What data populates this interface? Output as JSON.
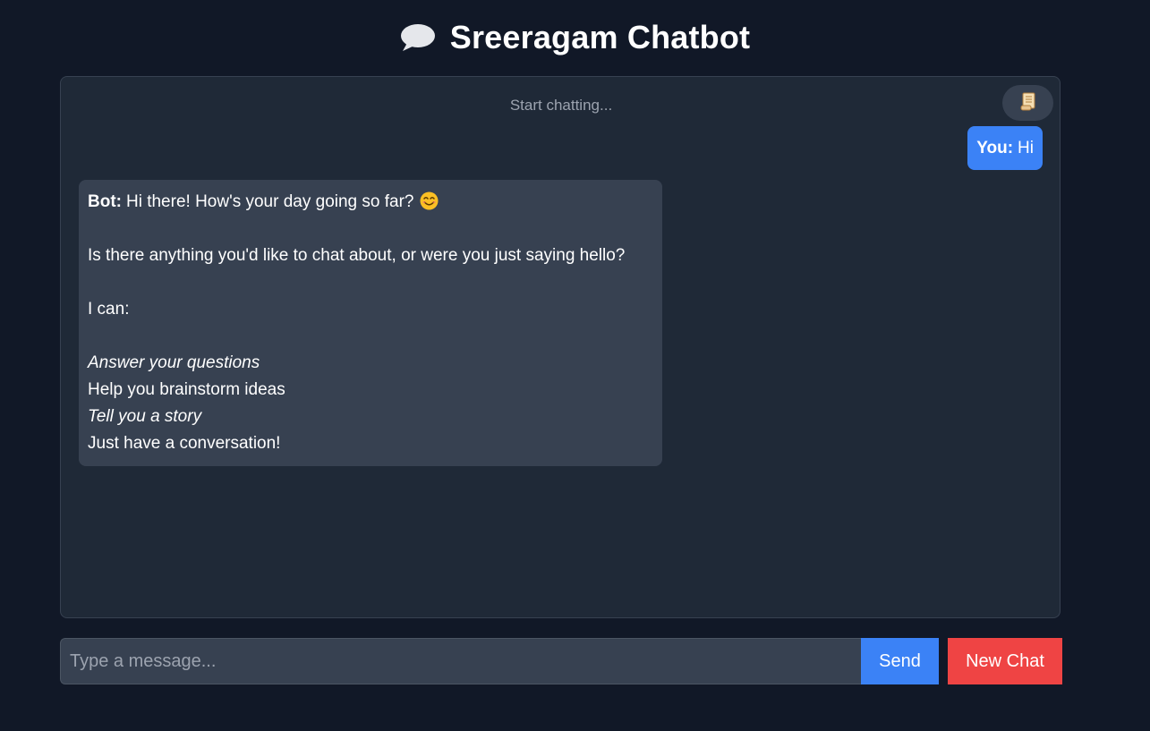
{
  "header": {
    "icon": "speech-bubble-icon",
    "title": "Sreeragam Chatbot"
  },
  "chat": {
    "placeholder": "Start chatting...",
    "history_button_icon": "scroll-icon",
    "messages": [
      {
        "role": "user",
        "sender": "You:",
        "text": "Hi"
      },
      {
        "role": "bot",
        "sender": "Bot:",
        "lines": [
          "Hi there! How's your day going so far?",
          "",
          "Is there anything you'd like to chat about, or were you just saying hello?",
          "",
          "I can:",
          "",
          "Answer your questions",
          "Help you brainstorm ideas",
          "Tell you a story",
          "Just have a conversation!"
        ],
        "emoji_icon": "smiling-face-icon"
      }
    ]
  },
  "input": {
    "placeholder": "Type a message...",
    "value": "",
    "send_label": "Send",
    "new_chat_label": "New Chat"
  },
  "colors": {
    "page_background": "#111827",
    "panel_background": "#1f2937",
    "bot_bubble": "#374151",
    "user_bubble": "#3b82f6",
    "send_button": "#3b82f6",
    "new_chat_button": "#ef4444",
    "muted_text": "#9ca3af"
  }
}
